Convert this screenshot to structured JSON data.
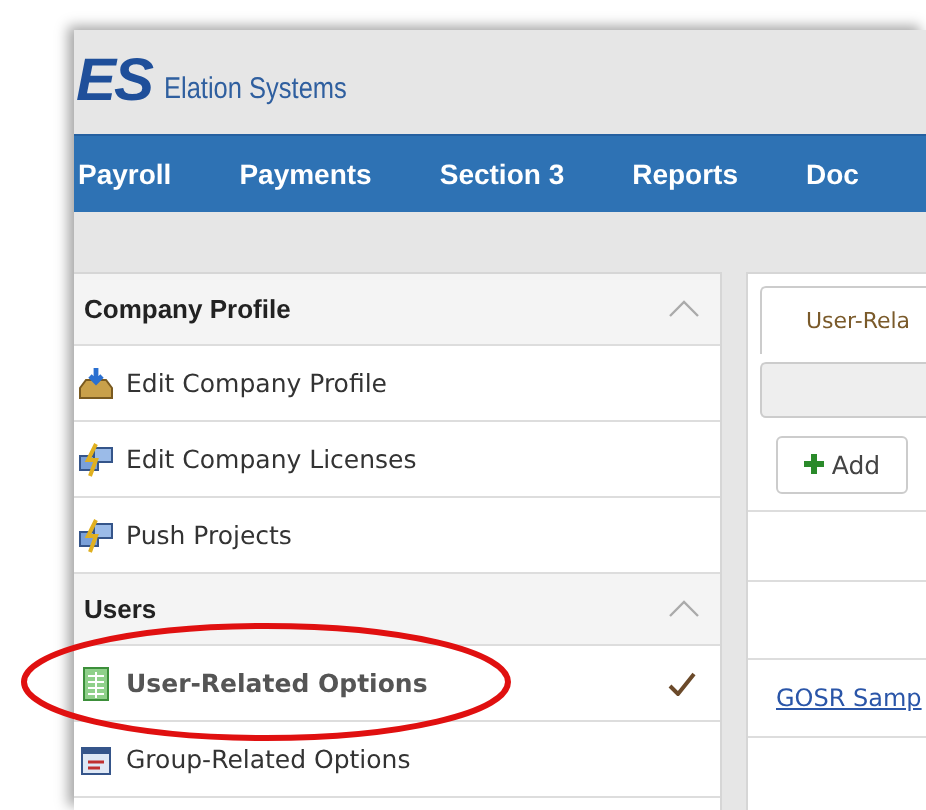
{
  "header": {
    "logo_mark": "ES",
    "company": "Elation Systems"
  },
  "nav": [
    {
      "label": "Payroll"
    },
    {
      "label": "Payments"
    },
    {
      "label": "Section 3"
    },
    {
      "label": "Reports"
    },
    {
      "label": "Doc"
    }
  ],
  "sidebar": [
    {
      "title": "Company Profile",
      "expanded": true,
      "items": [
        {
          "label": "Edit Company Profile",
          "kind": "inbox",
          "selected": false
        },
        {
          "label": "Edit Company Licenses",
          "kind": "network",
          "selected": false
        },
        {
          "label": "Push Projects",
          "kind": "network",
          "selected": false
        }
      ]
    },
    {
      "title": "Users",
      "expanded": true,
      "items": [
        {
          "label": "User-Related Options",
          "kind": "sheet",
          "selected": true
        },
        {
          "label": "Group-Related Options",
          "kind": "form",
          "selected": false
        }
      ]
    }
  ],
  "content": {
    "tab": "User-Rela",
    "add_button": "Add",
    "link": "GOSR Samp"
  }
}
